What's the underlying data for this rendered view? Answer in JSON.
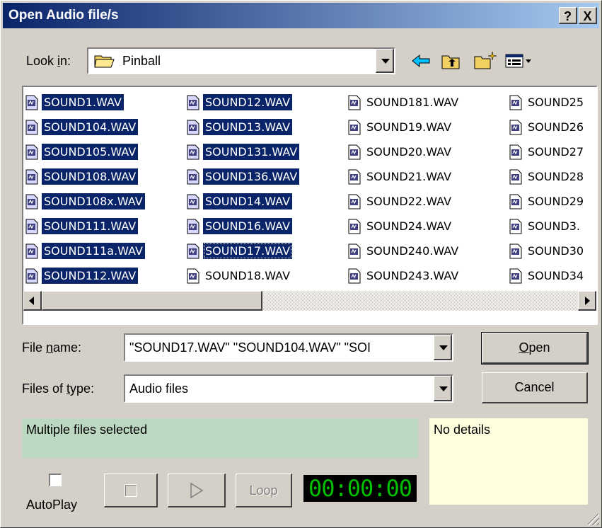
{
  "window": {
    "title": "Open Audio file/s",
    "help_label": "?",
    "close_label": "X"
  },
  "lookin": {
    "label": "Look in:",
    "value": "Pinball",
    "folder_icon": "folder-icon"
  },
  "toolbar": {
    "back_icon": "back-arrow-icon",
    "up_icon": "up-folder-icon",
    "newfolder_icon": "new-folder-icon",
    "view_icon": "view-menu-icon"
  },
  "files": {
    "columns": [
      [
        {
          "name": "SOUND1.WAV",
          "selected": true
        },
        {
          "name": "SOUND104.WAV",
          "selected": true
        },
        {
          "name": "SOUND105.WAV",
          "selected": true
        },
        {
          "name": "SOUND108.WAV",
          "selected": true
        },
        {
          "name": "SOUND108x.WAV",
          "selected": true
        },
        {
          "name": "SOUND111.WAV",
          "selected": true
        },
        {
          "name": "SOUND111a.WAV",
          "selected": true
        },
        {
          "name": "SOUND112.WAV",
          "selected": true
        }
      ],
      [
        {
          "name": "SOUND12.WAV",
          "selected": true
        },
        {
          "name": "SOUND13.WAV",
          "selected": true
        },
        {
          "name": "SOUND131.WAV",
          "selected": true
        },
        {
          "name": "SOUND136.WAV",
          "selected": true
        },
        {
          "name": "SOUND14.WAV",
          "selected": true
        },
        {
          "name": "SOUND16.WAV",
          "selected": true
        },
        {
          "name": "SOUND17.WAV",
          "selected": true,
          "focused": true
        },
        {
          "name": "SOUND18.WAV",
          "selected": false
        }
      ],
      [
        {
          "name": "SOUND181.WAV",
          "selected": false
        },
        {
          "name": "SOUND19.WAV",
          "selected": false
        },
        {
          "name": "SOUND20.WAV",
          "selected": false
        },
        {
          "name": "SOUND21.WAV",
          "selected": false
        },
        {
          "name": "SOUND22.WAV",
          "selected": false
        },
        {
          "name": "SOUND24.WAV",
          "selected": false
        },
        {
          "name": "SOUND240.WAV",
          "selected": false
        },
        {
          "name": "SOUND243.WAV",
          "selected": false
        }
      ],
      [
        {
          "name": "SOUND25",
          "selected": false
        },
        {
          "name": "SOUND26",
          "selected": false
        },
        {
          "name": "SOUND27",
          "selected": false
        },
        {
          "name": "SOUND28",
          "selected": false
        },
        {
          "name": "SOUND29",
          "selected": false
        },
        {
          "name": "SOUND3.",
          "selected": false
        },
        {
          "name": "SOUND30",
          "selected": false
        },
        {
          "name": "SOUND34",
          "selected": false
        }
      ]
    ]
  },
  "filename": {
    "label": "File name:",
    "value": "\"SOUND17.WAV\" \"SOUND104.WAV\" \"SOI"
  },
  "filetype": {
    "label": "Files of type:",
    "value": "Audio files"
  },
  "buttons": {
    "open": "Open",
    "cancel": "Cancel",
    "loop": "Loop"
  },
  "info": {
    "status": "Multiple files selected",
    "details": "No details"
  },
  "player": {
    "autoplay_label": "AutoPlay",
    "autoplay_checked": false,
    "timer": "00:00:00"
  },
  "colors": {
    "title_gradient_start": "#0a246a",
    "title_gradient_end": "#a6caf0",
    "selection": "#0a246a",
    "status_bg": "#bcd8c0",
    "details_bg": "#ffffe0",
    "timer_fg": "#00c000"
  }
}
